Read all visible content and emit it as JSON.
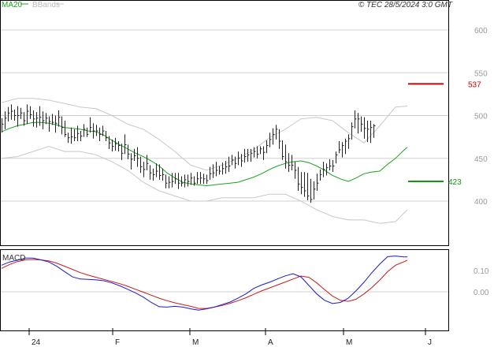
{
  "header": {
    "ma_label": "MA20",
    "bbands_label": "BBands",
    "stamp": "© TEC 28/5/2024 3:0 GMT"
  },
  "colors": {
    "price": "#222222",
    "ma20": "#1aa31a",
    "bands": "#c8c8c8",
    "resistance": "#cc0000",
    "support": "#119911",
    "macd": "#1a1acc",
    "signal": "#cc1a1a",
    "grid": "#d0d0d0"
  },
  "chart_data": [
    {
      "type": "line",
      "panel": "price",
      "y_ticks": [
        400,
        450,
        500,
        550,
        600
      ],
      "y_tick_labels": [
        "400",
        "450",
        "500",
        "550",
        "600"
      ],
      "ylim": [
        370,
        625
      ],
      "x_tick_labels": [
        "24",
        "F",
        "M",
        "A",
        "M",
        "J"
      ],
      "levels": [
        {
          "value": 537,
          "label": "537",
          "kind": "resistance"
        },
        {
          "value": 423,
          "label": "423",
          "kind": "support"
        }
      ],
      "series": [
        {
          "name": "MA20",
          "x": [
            0,
            10,
            20,
            30,
            40,
            50,
            60,
            70,
            80,
            90,
            100,
            110,
            120,
            130,
            140,
            150,
            160,
            170,
            180,
            190,
            200,
            210,
            220,
            230,
            240,
            250,
            260,
            270,
            280,
            290,
            300,
            310,
            320,
            330,
            340,
            350,
            360,
            370,
            380,
            390,
            400,
            410,
            420,
            430,
            440,
            450,
            460,
            470,
            480,
            490,
            500,
            510,
            515
          ],
          "values": [
            481,
            485,
            488,
            490,
            492,
            492,
            491,
            489,
            486,
            485,
            484,
            482,
            481,
            477,
            471,
            466,
            461,
            456,
            452,
            447,
            441,
            433,
            427,
            422,
            420,
            419,
            418,
            419,
            420,
            421,
            422,
            425,
            428,
            432,
            437,
            441,
            444,
            446,
            447,
            445,
            441,
            436,
            430,
            426,
            423,
            427,
            432,
            434,
            435,
            443,
            450,
            459,
            463
          ]
        },
        {
          "name": "BBands upper",
          "x": [
            0,
            20,
            40,
            60,
            80,
            100,
            120,
            140,
            160,
            180,
            200,
            220,
            240,
            260,
            280,
            300,
            320,
            340,
            360,
            380,
            400,
            420,
            440,
            460,
            480,
            500,
            515
          ],
          "values": [
            515,
            520,
            520,
            518,
            514,
            510,
            508,
            500,
            490,
            484,
            472,
            458,
            442,
            436,
            442,
            450,
            460,
            474,
            484,
            496,
            498,
            494,
            480,
            468,
            488,
            510,
            511
          ]
        },
        {
          "name": "BBands lower",
          "x": [
            0,
            20,
            40,
            60,
            80,
            100,
            120,
            140,
            160,
            180,
            200,
            220,
            240,
            260,
            280,
            300,
            320,
            340,
            360,
            380,
            400,
            420,
            440,
            460,
            480,
            500,
            515
          ],
          "values": [
            450,
            452,
            458,
            464,
            458,
            458,
            454,
            446,
            436,
            422,
            412,
            406,
            400,
            400,
            404,
            404,
            404,
            408,
            408,
            400,
            390,
            382,
            378,
            378,
            374,
            376,
            390
          ]
        }
      ],
      "ohlc": {
        "x": [
          0,
          4,
          8,
          12,
          16,
          20,
          24,
          28,
          32,
          36,
          40,
          44,
          48,
          52,
          56,
          60,
          64,
          68,
          72,
          76,
          80,
          84,
          88,
          92,
          96,
          100,
          104,
          108,
          112,
          116,
          120,
          124,
          128,
          132,
          136,
          140,
          144,
          148,
          152,
          156,
          160,
          164,
          168,
          172,
          176,
          180,
          184,
          188,
          192,
          196,
          200,
          204,
          208,
          212,
          216,
          220,
          224,
          228,
          232,
          236,
          240,
          244,
          248,
          252,
          256,
          260,
          264,
          268,
          272,
          276,
          280,
          284,
          288,
          292,
          296,
          300,
          304,
          308,
          312,
          316,
          320,
          324,
          328,
          332,
          336,
          340,
          344,
          348,
          352,
          356,
          360,
          364,
          368,
          372,
          376,
          380,
          384,
          388,
          392,
          396,
          400,
          404,
          408,
          412,
          416,
          420,
          424,
          428,
          432,
          436,
          440,
          444,
          448,
          452,
          456,
          460,
          464,
          468,
          472,
          476,
          480,
          484,
          488,
          492,
          496,
          500,
          504,
          508,
          512,
          516
        ],
        "high": [
          497,
          505,
          510,
          513,
          507,
          511,
          509,
          504,
          513,
          511,
          506,
          504,
          511,
          505,
          503,
          499,
          502,
          500,
          506,
          499,
          494,
          480,
          486,
          484,
          488,
          482,
          490,
          486,
          498,
          491,
          489,
          486,
          488,
          482,
          476,
          472,
          474,
          470,
          467,
          478,
          466,
          456,
          461,
          463,
          452,
          446,
          454,
          442,
          438,
          444,
          443,
          438,
          431,
          429,
          433,
          433,
          433,
          429,
          431,
          431,
          433,
          429,
          434,
          434,
          432,
          431,
          440,
          443,
          446,
          441,
          445,
          447,
          452,
          454,
          452,
          458,
          455,
          461,
          461,
          461,
          463,
          464,
          464,
          464,
          471,
          480,
          485,
          489,
          484,
          471,
          466,
          456,
          454,
          446,
          440,
          434,
          434,
          433,
          426,
          423,
          432,
          437,
          446,
          444,
          449,
          448,
          458,
          470,
          469,
          473,
          478,
          492,
          506,
          503,
          499,
          498,
          494,
          494,
          490
        ],
        "low": [
          480,
          484,
          493,
          495,
          494,
          487,
          496,
          488,
          490,
          496,
          487,
          486,
          488,
          484,
          490,
          481,
          489,
          480,
          487,
          478,
          475,
          468,
          467,
          470,
          470,
          470,
          475,
          475,
          480,
          473,
          476,
          470,
          476,
          470,
          461,
          458,
          459,
          458,
          448,
          455,
          449,
          437,
          447,
          440,
          433,
          428,
          436,
          425,
          424,
          428,
          425,
          424,
          415,
          415,
          416,
          420,
          414,
          417,
          416,
          417,
          419,
          418,
          420,
          420,
          420,
          420,
          425,
          427,
          429,
          431,
          431,
          432,
          434,
          442,
          438,
          442,
          440,
          445,
          446,
          446,
          451,
          450,
          455,
          448,
          456,
          463,
          466,
          472,
          461,
          448,
          438,
          434,
          436,
          426,
          412,
          408,
          405,
          401,
          398,
          402,
          412,
          424,
          428,
          430,
          436,
          434,
          444,
          456,
          451,
          455,
          461,
          472,
          485,
          479,
          481,
          473,
          469,
          468,
          474
        ],
        "close": [
          490,
          497,
          503,
          505,
          500,
          500,
          503,
          494,
          505,
          501,
          496,
          497,
          498,
          494,
          497,
          493,
          492,
          491,
          498,
          486,
          478,
          474,
          475,
          474,
          479,
          476,
          484,
          478,
          486,
          482,
          482,
          478,
          482,
          474,
          468,
          464,
          467,
          465,
          456,
          466,
          455,
          449,
          453,
          450,
          440,
          437,
          444,
          433,
          431,
          435,
          430,
          431,
          421,
          422,
          423,
          426,
          421,
          421,
          425,
          423,
          427,
          421,
          426,
          427,
          426,
          424,
          432,
          433,
          436,
          435,
          438,
          440,
          441,
          448,
          444,
          450,
          447,
          452,
          454,
          456,
          458,
          455,
          461,
          457,
          465,
          472,
          478,
          484,
          470,
          452,
          446,
          442,
          442,
          436,
          420,
          416,
          412,
          406,
          402,
          414,
          421,
          431,
          437,
          439,
          441,
          441,
          454,
          460,
          465,
          470,
          473,
          487,
          496,
          496,
          490,
          485,
          484,
          486,
          488
        ]
      }
    },
    {
      "type": "line",
      "panel": "MACD",
      "title": "MACD",
      "y_ticks": [
        0.1,
        0.0
      ],
      "y_tick_labels": [
        "0.10",
        "0.00"
      ],
      "ylim": [
        -0.2,
        0.2
      ],
      "series": [
        {
          "name": "MACD",
          "x": [
            0,
            10,
            20,
            30,
            40,
            50,
            60,
            70,
            80,
            90,
            100,
            110,
            120,
            130,
            140,
            150,
            160,
            170,
            180,
            190,
            200,
            210,
            220,
            230,
            240,
            250,
            260,
            270,
            280,
            290,
            300,
            310,
            320,
            330,
            340,
            350,
            360,
            370,
            380,
            390,
            400,
            410,
            420,
            430,
            440,
            450,
            460,
            470,
            480,
            490,
            500,
            510,
            515
          ],
          "values": [
            0.125,
            0.14,
            0.148,
            0.158,
            0.158,
            0.15,
            0.14,
            0.12,
            0.095,
            0.07,
            0.06,
            0.058,
            0.056,
            0.052,
            0.042,
            0.028,
            0.012,
            -0.005,
            -0.025,
            -0.05,
            -0.07,
            -0.072,
            -0.068,
            -0.072,
            -0.08,
            -0.086,
            -0.08,
            -0.072,
            -0.06,
            -0.048,
            -0.03,
            -0.01,
            0.016,
            0.032,
            0.045,
            0.06,
            0.075,
            0.085,
            0.07,
            0.03,
            -0.01,
            -0.04,
            -0.055,
            -0.05,
            -0.03,
            0.005,
            0.045,
            0.09,
            0.13,
            0.165,
            0.168,
            0.164,
            0.164
          ]
        },
        {
          "name": "Signal",
          "x": [
            0,
            10,
            20,
            30,
            40,
            50,
            60,
            70,
            80,
            90,
            100,
            110,
            120,
            130,
            140,
            150,
            160,
            170,
            180,
            190,
            200,
            210,
            220,
            230,
            240,
            250,
            260,
            270,
            280,
            290,
            300,
            310,
            320,
            330,
            340,
            350,
            360,
            370,
            380,
            390,
            400,
            410,
            420,
            430,
            440,
            450,
            460,
            470,
            480,
            490,
            500,
            510,
            515
          ],
          "values": [
            0.11,
            0.128,
            0.142,
            0.15,
            0.152,
            0.15,
            0.145,
            0.135,
            0.12,
            0.105,
            0.09,
            0.078,
            0.068,
            0.058,
            0.048,
            0.038,
            0.026,
            0.012,
            -0.002,
            -0.016,
            -0.03,
            -0.042,
            -0.052,
            -0.06,
            -0.068,
            -0.078,
            -0.078,
            -0.072,
            -0.064,
            -0.054,
            -0.042,
            -0.028,
            -0.012,
            0.004,
            0.018,
            0.032,
            0.046,
            0.06,
            0.074,
            0.068,
            0.042,
            0.01,
            -0.02,
            -0.04,
            -0.045,
            -0.035,
            -0.01,
            0.02,
            0.055,
            0.095,
            0.125,
            0.14,
            0.148
          ]
        }
      ]
    }
  ]
}
